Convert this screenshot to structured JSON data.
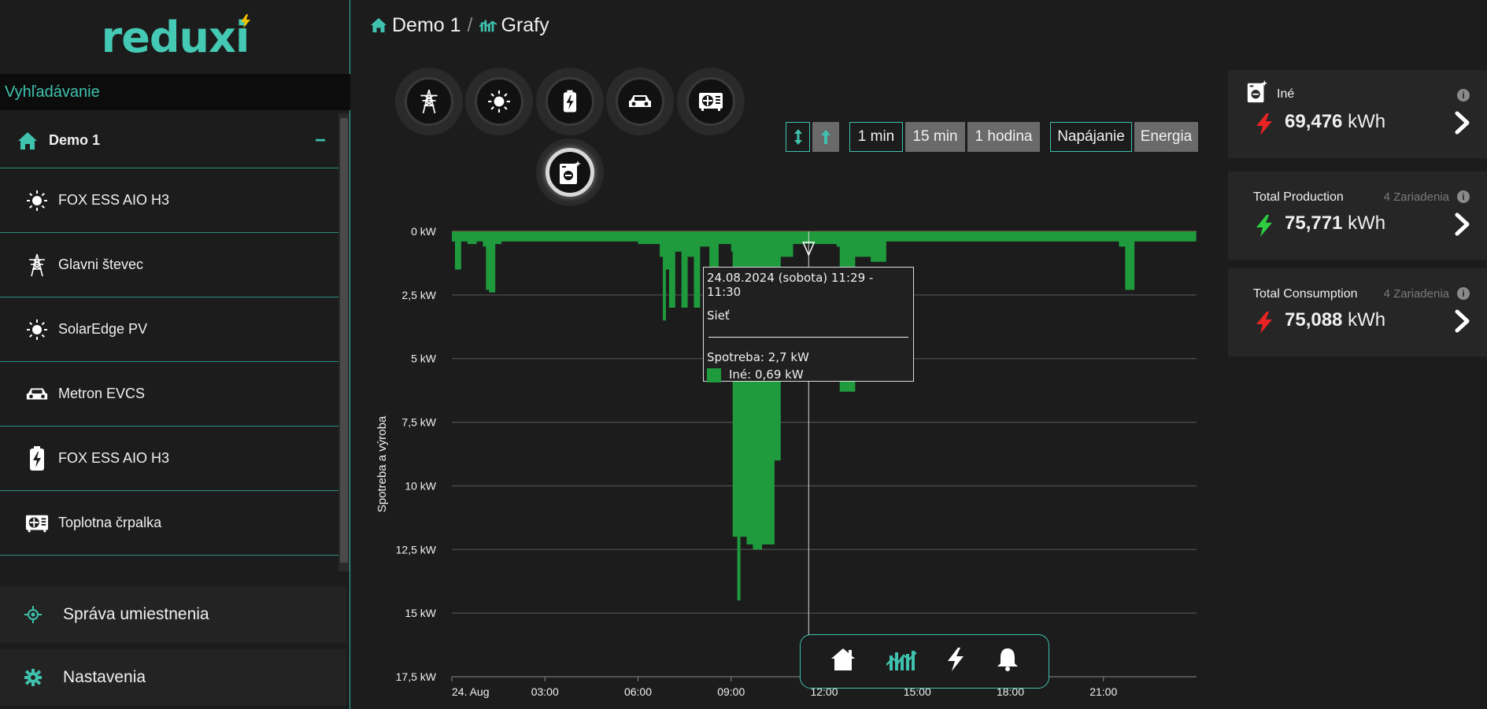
{
  "app": {
    "logo": "reduxi"
  },
  "sidebar": {
    "search_label": "Vyhľadávanie",
    "root": {
      "label": "Demo 1",
      "collapse": "−"
    },
    "items": [
      {
        "label": "FOX ESS AIO H3",
        "icon": "sun-icon"
      },
      {
        "label": "Glavni števec",
        "icon": "power-tower-icon"
      },
      {
        "label": "SolarEdge PV",
        "icon": "sun-icon"
      },
      {
        "label": "Metron EVCS",
        "icon": "car-icon"
      },
      {
        "label": "FOX ESS AIO H3",
        "icon": "battery-icon"
      },
      {
        "label": "Toplotna črpalka",
        "icon": "heat-pump-icon"
      }
    ],
    "nav": [
      {
        "label": "Správa umiestnenia",
        "icon": "location-icon"
      },
      {
        "label": "Nastavenia",
        "icon": "gear-icon"
      }
    ]
  },
  "breadcrumb": {
    "home": "Demo 1",
    "separator": "/",
    "page": "Grafy"
  },
  "devices": [
    "power-tower-icon",
    "sun-icon",
    "battery-icon",
    "car-icon",
    "heat-pump-icon",
    "appliance-icon"
  ],
  "controls": {
    "resolution": [
      "1 min",
      "15 min",
      "1 hodina"
    ],
    "mode": [
      "Napájanie",
      "Energia"
    ]
  },
  "chart_data": {
    "type": "area",
    "ylabel": "Spotreba a výroba",
    "y_ticks": [
      "0 kW",
      "2,5 kW",
      "5 kW",
      "7,5 kW",
      "10 kW",
      "12,5 kW",
      "15 kW",
      "17,5 kW"
    ],
    "ylim": [
      0,
      17.5
    ],
    "x_ticks": [
      "24. Aug",
      "03:00",
      "06:00",
      "09:00",
      "12:00",
      "15:00",
      "18:00",
      "21:00"
    ],
    "series": [
      {
        "name": "Iné",
        "color": "#1f9a3c",
        "x_hours": [
          0,
          0.1,
          0.3,
          0.5,
          0.8,
          1.0,
          1.1,
          1.2,
          1.4,
          1.6,
          2.0,
          3.0,
          4.0,
          5.0,
          6.0,
          6.7,
          6.8,
          6.9,
          7.0,
          7.2,
          7.4,
          7.6,
          7.8,
          8.0,
          8.3,
          8.6,
          9.0,
          9.05,
          9.2,
          9.3,
          9.5,
          9.7,
          10.0,
          10.4,
          10.6,
          11.0,
          11.5,
          12.0,
          12.4,
          12.5,
          13.0,
          13.5,
          14.0,
          15.0,
          16.0,
          17.0,
          18.0,
          19.0,
          20.0,
          21.0,
          21.5,
          21.7,
          22.0,
          23.0,
          23.99
        ],
        "values": [
          0.4,
          1.5,
          0.4,
          0.5,
          0.4,
          0.6,
          2.3,
          2.4,
          0.5,
          0.4,
          0.4,
          0.4,
          0.4,
          0.4,
          0.5,
          1.0,
          3.5,
          1.5,
          3.0,
          0.8,
          3.0,
          1.0,
          3.0,
          0.6,
          1.5,
          0.5,
          0.8,
          12.0,
          14.5,
          12.0,
          12.3,
          12.5,
          12.3,
          9.0,
          1.0,
          0.5,
          0.5,
          0.5,
          0.6,
          6.3,
          1.0,
          1.2,
          0.4,
          0.4,
          0.4,
          0.4,
          0.4,
          0.4,
          0.4,
          0.4,
          0.6,
          2.3,
          0.4,
          0.4,
          0.4
        ]
      }
    ]
  },
  "tooltip": {
    "time": "24.08.2024 (sobota) 11:29 - 11:30",
    "source": "Sieť",
    "consumption": "Spotreba: 2,7 kW",
    "series_label": "Iné:",
    "series_value": "0,69 kW"
  },
  "cards": [
    {
      "title": "Iné",
      "sub": "",
      "value": "69,476",
      "unit": "kWh",
      "bolt_color": "#e82323"
    },
    {
      "title": "Total Production",
      "sub": "4 Zariadenia",
      "value": "75,771",
      "unit": "kWh",
      "bolt_color": "#2ecc40"
    },
    {
      "title": "Total Consumption",
      "sub": "4 Zariadenia",
      "value": "75,088",
      "unit": "kWh",
      "bolt_color": "#e82323"
    }
  ],
  "bottomnav": [
    "home-icon",
    "chart-icon",
    "bolt-icon",
    "bell-icon"
  ],
  "info_glyph": "i"
}
